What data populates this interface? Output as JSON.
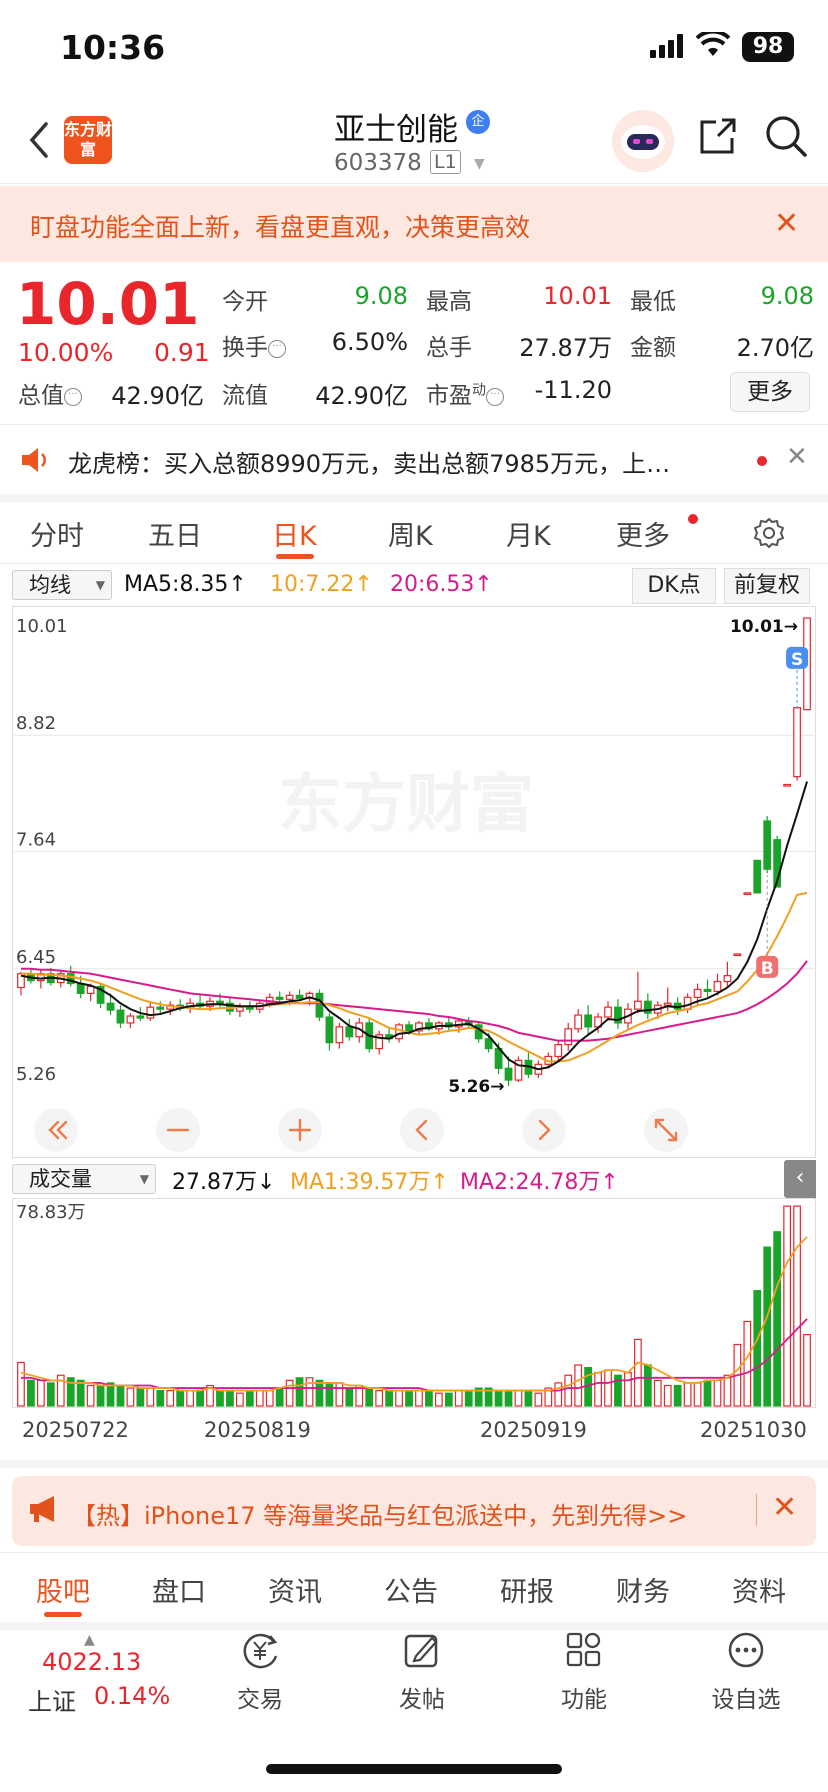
{
  "status": {
    "time": "10:36",
    "battery": "98"
  },
  "header": {
    "logo_text": "东方财富",
    "name": "亚士创能",
    "qi_badge": "企",
    "code": "603378",
    "level": "L1"
  },
  "notice": {
    "text": "盯盘功能全面上新，看盘更直观，决策更高效"
  },
  "quote": {
    "price": "10.01",
    "change_pct": "10.00%",
    "change": "0.91",
    "open_label": "今开",
    "open": "9.08",
    "high_label": "最高",
    "high": "10.01",
    "low_label": "最低",
    "low": "9.08",
    "turnover_label": "换手",
    "turnover": "6.50%",
    "volume_label": "总手",
    "volume": "27.87万",
    "amount_label": "金额",
    "amount": "2.70亿",
    "mktcap_label": "总值",
    "mktcap": "42.90亿",
    "float_label": "流值",
    "float": "42.90亿",
    "pe_label": "市盈",
    "pe_sup": "动",
    "pe": "-11.20",
    "more_label": "更多"
  },
  "dragon": {
    "text": "龙虎榜：买入总额8990万元，卖出总额7985万元，上…"
  },
  "period_tabs": [
    "分时",
    "五日",
    "日K",
    "周K",
    "月K",
    "更多"
  ],
  "period_active": 2,
  "ma_row": {
    "dropdown": "均线",
    "ma5": "MA5:8.35↑",
    "ma10": "10:7.22↑",
    "ma20": "20:6.53↑",
    "dk_label": "DK点",
    "adjust_label": "前复权"
  },
  "volume_header": {
    "dropdown": "成交量",
    "amount": "27.87万↓",
    "ma1": "MA1:39.57万↑",
    "ma2": "MA2:24.78万↑",
    "collapse": "‹"
  },
  "chart_data": {
    "type": "candlestick",
    "y_labels": [
      "10.01",
      "8.82",
      "7.64",
      "6.45",
      "5.26"
    ],
    "ylim": [
      5.26,
      10.01
    ],
    "max_annotation": "10.01→",
    "min_annotation": "5.26→",
    "watermark": "东方财富",
    "marker_s": "S",
    "marker_b": "B",
    "candles": [
      [
        6.26,
        6.42,
        6.18,
        6.4
      ],
      [
        6.4,
        6.45,
        6.3,
        6.33
      ],
      [
        6.33,
        6.44,
        6.25,
        6.4
      ],
      [
        6.4,
        6.46,
        6.28,
        6.31
      ],
      [
        6.31,
        6.44,
        6.26,
        6.4
      ],
      [
        6.4,
        6.48,
        6.27,
        6.3
      ],
      [
        6.3,
        6.38,
        6.15,
        6.2
      ],
      [
        6.2,
        6.3,
        6.12,
        6.27
      ],
      [
        6.27,
        6.3,
        6.05,
        6.1
      ],
      [
        6.1,
        6.2,
        5.98,
        6.03
      ],
      [
        6.03,
        6.08,
        5.85,
        5.9
      ],
      [
        5.9,
        6.0,
        5.85,
        5.97
      ],
      [
        5.97,
        6.06,
        5.92,
        5.95
      ],
      [
        5.95,
        6.1,
        5.92,
        6.06
      ],
      [
        6.06,
        6.12,
        6.0,
        6.04
      ],
      [
        6.04,
        6.12,
        5.98,
        6.08
      ],
      [
        6.08,
        6.14,
        6.02,
        6.05
      ],
      [
        6.05,
        6.15,
        6.0,
        6.1
      ],
      [
        6.1,
        6.18,
        6.04,
        6.07
      ],
      [
        6.07,
        6.16,
        6.02,
        6.12
      ],
      [
        6.12,
        6.2,
        6.06,
        6.1
      ],
      [
        6.1,
        6.15,
        5.98,
        6.02
      ],
      [
        6.02,
        6.1,
        5.96,
        6.06
      ],
      [
        6.06,
        6.12,
        6.0,
        6.04
      ],
      [
        6.04,
        6.13,
        6.0,
        6.1
      ],
      [
        6.1,
        6.2,
        6.06,
        6.16
      ],
      [
        6.16,
        6.22,
        6.1,
        6.14
      ],
      [
        6.14,
        6.22,
        6.08,
        6.18
      ],
      [
        6.18,
        6.24,
        6.12,
        6.15
      ],
      [
        6.15,
        6.22,
        6.08,
        6.2
      ],
      [
        6.2,
        6.24,
        5.92,
        5.96
      ],
      [
        5.96,
        6.0,
        5.62,
        5.7
      ],
      [
        5.7,
        5.9,
        5.64,
        5.86
      ],
      [
        5.86,
        5.94,
        5.72,
        5.76
      ],
      [
        5.76,
        5.95,
        5.7,
        5.9
      ],
      [
        5.9,
        5.96,
        5.6,
        5.64
      ],
      [
        5.64,
        5.82,
        5.58,
        5.78
      ],
      [
        5.78,
        5.86,
        5.7,
        5.74
      ],
      [
        5.74,
        5.9,
        5.7,
        5.88
      ],
      [
        5.88,
        5.92,
        5.78,
        5.82
      ],
      [
        5.82,
        5.92,
        5.78,
        5.9
      ],
      [
        5.9,
        5.95,
        5.82,
        5.84
      ],
      [
        5.84,
        5.92,
        5.78,
        5.9
      ],
      [
        5.9,
        5.96,
        5.82,
        5.86
      ],
      [
        5.86,
        5.94,
        5.8,
        5.92
      ],
      [
        5.92,
        5.96,
        5.84,
        5.88
      ],
      [
        5.88,
        5.92,
        5.7,
        5.74
      ],
      [
        5.74,
        5.8,
        5.6,
        5.64
      ],
      [
        5.64,
        5.7,
        5.38,
        5.44
      ],
      [
        5.44,
        5.56,
        5.26,
        5.32
      ],
      [
        5.32,
        5.56,
        5.3,
        5.52
      ],
      [
        5.52,
        5.62,
        5.34,
        5.38
      ],
      [
        5.38,
        5.52,
        5.34,
        5.48
      ],
      [
        5.48,
        5.6,
        5.44,
        5.56
      ],
      [
        5.56,
        5.72,
        5.5,
        5.68
      ],
      [
        5.68,
        5.9,
        5.62,
        5.84
      ],
      [
        5.84,
        6.04,
        5.8,
        5.98
      ],
      [
        5.98,
        6.08,
        5.78,
        5.86
      ],
      [
        5.86,
        6.0,
        5.8,
        5.96
      ],
      [
        5.96,
        6.12,
        5.92,
        6.06
      ],
      [
        6.06,
        6.14,
        5.84,
        5.9
      ],
      [
        5.9,
        6.1,
        5.84,
        6.04
      ],
      [
        6.04,
        6.42,
        6.0,
        6.12
      ],
      [
        6.12,
        6.2,
        5.94,
        6.0
      ],
      [
        6.0,
        6.12,
        5.94,
        6.08
      ],
      [
        6.08,
        6.26,
        6.02,
        6.1
      ],
      [
        6.1,
        6.16,
        5.98,
        6.04
      ],
      [
        6.04,
        6.2,
        6.0,
        6.16
      ],
      [
        6.16,
        6.3,
        6.08,
        6.24
      ],
      [
        6.24,
        6.34,
        6.16,
        6.22
      ],
      [
        6.22,
        6.4,
        6.18,
        6.32
      ],
      [
        6.32,
        6.52,
        6.26,
        6.38
      ],
      [
        6.6,
        6.6,
        6.6,
        6.6
      ],
      [
        7.22,
        7.22,
        7.22,
        7.22
      ],
      [
        7.55,
        7.55,
        7.22,
        7.22
      ],
      [
        7.95,
        8.0,
        7.42,
        7.46
      ],
      [
        7.76,
        7.8,
        7.28,
        7.28
      ],
      [
        8.32,
        8.32,
        8.32,
        8.32
      ],
      [
        8.4,
        9.1,
        8.36,
        9.1
      ],
      [
        9.08,
        10.01,
        9.08,
        10.01
      ]
    ],
    "ma5": [
      6.38,
      6.36,
      6.35,
      6.36,
      6.35,
      6.33,
      6.3,
      6.28,
      6.24,
      6.18,
      6.1,
      6.04,
      6.0,
      5.98,
      5.99,
      6.02,
      6.05,
      6.07,
      6.08,
      6.09,
      6.09,
      6.08,
      6.07,
      6.07,
      6.07,
      6.09,
      6.1,
      6.12,
      6.13,
      6.16,
      6.13,
      6.02,
      5.95,
      5.87,
      5.84,
      5.77,
      5.75,
      5.74,
      5.79,
      5.8,
      5.84,
      5.85,
      5.87,
      5.87,
      5.88,
      5.89,
      5.84,
      5.77,
      5.65,
      5.53,
      5.47,
      5.46,
      5.43,
      5.45,
      5.51,
      5.59,
      5.7,
      5.78,
      5.85,
      5.94,
      5.93,
      5.97,
      6.02,
      6.03,
      6.04,
      6.07,
      6.06,
      6.08,
      6.12,
      6.15,
      6.2,
      6.26,
      6.35,
      6.52,
      6.75,
      7.06,
      7.34,
      7.7,
      8.02,
      8.35
    ],
    "ma10": [
      6.4,
      6.4,
      6.39,
      6.39,
      6.38,
      6.37,
      6.35,
      6.33,
      6.3,
      6.26,
      6.22,
      6.18,
      6.14,
      6.11,
      6.09,
      6.07,
      6.06,
      6.05,
      6.04,
      6.04,
      6.05,
      6.05,
      6.06,
      6.07,
      6.07,
      6.08,
      6.09,
      6.1,
      6.1,
      6.11,
      6.11,
      6.08,
      6.05,
      6.01,
      5.98,
      5.95,
      5.9,
      5.85,
      5.83,
      5.8,
      5.78,
      5.79,
      5.8,
      5.82,
      5.83,
      5.85,
      5.84,
      5.82,
      5.77,
      5.71,
      5.66,
      5.61,
      5.56,
      5.51,
      5.51,
      5.52,
      5.56,
      5.6,
      5.66,
      5.72,
      5.78,
      5.83,
      5.88,
      5.92,
      5.96,
      6.0,
      6.02,
      6.04,
      6.08,
      6.1,
      6.14,
      6.18,
      6.22,
      6.32,
      6.44,
      6.6,
      6.78,
      6.98,
      7.2,
      7.22
    ],
    "ma20": [
      6.45,
      6.45,
      6.44,
      6.44,
      6.43,
      6.42,
      6.41,
      6.4,
      6.38,
      6.36,
      6.34,
      6.32,
      6.3,
      6.28,
      6.26,
      6.24,
      6.22,
      6.2,
      6.19,
      6.18,
      6.17,
      6.16,
      6.15,
      6.14,
      6.13,
      6.12,
      6.11,
      6.11,
      6.1,
      6.1,
      6.1,
      6.09,
      6.08,
      6.07,
      6.06,
      6.05,
      6.04,
      6.03,
      6.02,
      6.01,
      6.0,
      5.99,
      5.97,
      5.96,
      5.94,
      5.92,
      5.91,
      5.89,
      5.87,
      5.84,
      5.8,
      5.78,
      5.76,
      5.74,
      5.72,
      5.72,
      5.72,
      5.72,
      5.73,
      5.74,
      5.76,
      5.78,
      5.8,
      5.82,
      5.84,
      5.86,
      5.88,
      5.9,
      5.92,
      5.94,
      5.96,
      5.98,
      6.0,
      6.04,
      6.09,
      6.15,
      6.22,
      6.3,
      6.4,
      6.53
    ]
  },
  "volume_data": {
    "ylabel_max": "78.83万",
    "ymax": 78.83,
    "dates": [
      "20250722",
      "20250819",
      "20250919",
      "20251030"
    ],
    "values": [
      17,
      10,
      10,
      9,
      12,
      11,
      10,
      8,
      8,
      9,
      8,
      7,
      7,
      7,
      6,
      6,
      6,
      6,
      6,
      8,
      6,
      6,
      5,
      6,
      6,
      6,
      7,
      10,
      11,
      11,
      10,
      9,
      9,
      7,
      8,
      7,
      6,
      6,
      6,
      6,
      6,
      6,
      5,
      5,
      6,
      6,
      7,
      7,
      6,
      6,
      6,
      6,
      5,
      7,
      9,
      12,
      16,
      15,
      13,
      14,
      12,
      13,
      26,
      16,
      10,
      8,
      8,
      9,
      9,
      10,
      10,
      12,
      24,
      33,
      45,
      62,
      68,
      78,
      78,
      27.87
    ],
    "ma1": [
      13,
      12,
      11,
      10,
      10,
      9,
      9,
      9,
      8,
      8,
      8,
      8,
      7,
      7,
      7,
      7,
      6,
      6,
      6,
      7,
      6,
      6,
      6,
      6,
      6,
      6,
      7,
      8,
      8,
      9,
      9,
      9,
      9,
      8,
      8,
      7,
      7,
      6,
      6,
      6,
      6,
      6,
      6,
      6,
      6,
      6,
      6,
      6,
      6,
      6,
      6,
      6,
      6,
      6,
      7,
      8,
      10,
      12,
      13,
      14,
      14,
      13,
      17,
      16,
      14,
      12,
      10,
      9,
      9,
      10,
      10,
      11,
      14,
      19,
      26,
      35,
      47,
      56,
      62,
      66
    ],
    "ma2": [
      11,
      11,
      10,
      10,
      10,
      9,
      9,
      9,
      9,
      8,
      8,
      8,
      8,
      8,
      7,
      7,
      7,
      7,
      7,
      7,
      7,
      7,
      7,
      7,
      7,
      7,
      7,
      7,
      7,
      7,
      7,
      7,
      7,
      7,
      7,
      7,
      7,
      7,
      7,
      7,
      7,
      6,
      6,
      6,
      6,
      6,
      6,
      6,
      6,
      6,
      6,
      6,
      6,
      6,
      6,
      7,
      7,
      8,
      9,
      9,
      10,
      10,
      11,
      11,
      11,
      11,
      11,
      11,
      11,
      11,
      11,
      11,
      12,
      13,
      15,
      18,
      22,
      26,
      30,
      34
    ]
  },
  "promo": {
    "text": "【热】iPhone17 等海量奖品与红包派送中，先到先得>>"
  },
  "content_tabs": [
    "股吧",
    "盘口",
    "资讯",
    "公告",
    "研报",
    "财务",
    "资料"
  ],
  "content_active": 0,
  "bottom_bar": {
    "index_value": "4022.13",
    "index_name": "上证",
    "index_pct": "0.14%",
    "items": [
      "交易",
      "发帖",
      "功能",
      "设自选"
    ]
  }
}
